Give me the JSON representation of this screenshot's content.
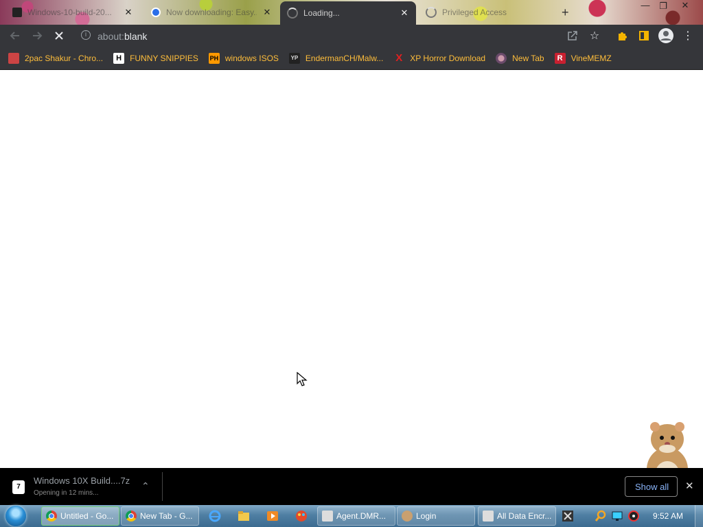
{
  "tabs": [
    {
      "title": "Windows-10-build-20...",
      "active": false,
      "icon": "archive-favicon-icon"
    },
    {
      "title": "Now downloading: Easy...",
      "active": false,
      "icon": "softpedia-favicon-icon"
    },
    {
      "title": "Loading...",
      "active": true,
      "icon": "loading-spinner-icon"
    },
    {
      "title": "Privileged Access",
      "active": false,
      "icon": "loading-spinner-icon"
    }
  ],
  "toolbar": {
    "url_scheme": "about:",
    "url_host": "blank"
  },
  "bookmarks": [
    {
      "label": "2pac Shakur - Chro...",
      "icon": "bookmark-image-icon"
    },
    {
      "label": "FUNNY SNIPPIES",
      "icon": "h-favicon-icon",
      "glyph": "H"
    },
    {
      "label": "windows ISOS",
      "icon": "ph-favicon-icon",
      "glyph": "PH"
    },
    {
      "label": "EndermanCH/Malw...",
      "icon": "youtube-favicon-icon",
      "glyph": "YP"
    },
    {
      "label": "XP Horror Download",
      "icon": "x-favicon-icon",
      "glyph": "X"
    },
    {
      "label": "New Tab",
      "icon": "globe-favicon-icon"
    },
    {
      "label": "VineMEMZ",
      "icon": "r-favicon-icon",
      "glyph": "R"
    }
  ],
  "download": {
    "filename": "Windows 10X Build....7z",
    "status": "Opening in 12 mins...",
    "icon_glyph": "7",
    "show_all_label": "Show all"
  },
  "taskbar": {
    "buttons": [
      {
        "label": "Untitled - Go...",
        "icon": "chrome-icon",
        "active": true
      },
      {
        "label": "New Tab - G...",
        "icon": "chrome-icon",
        "active": false
      },
      {
        "label": "Agent.DMR...",
        "icon": "window-icon",
        "active": false
      },
      {
        "label": "Login",
        "icon": "user-icon",
        "active": false
      },
      {
        "label": "All Data Encr...",
        "icon": "window-icon",
        "active": false
      }
    ],
    "clock": "9:52 AM"
  },
  "colors": {
    "chrome_dark": "#35363a",
    "bookmark_text": "#ffbe3b",
    "link_blue": "#8ab4f8"
  }
}
